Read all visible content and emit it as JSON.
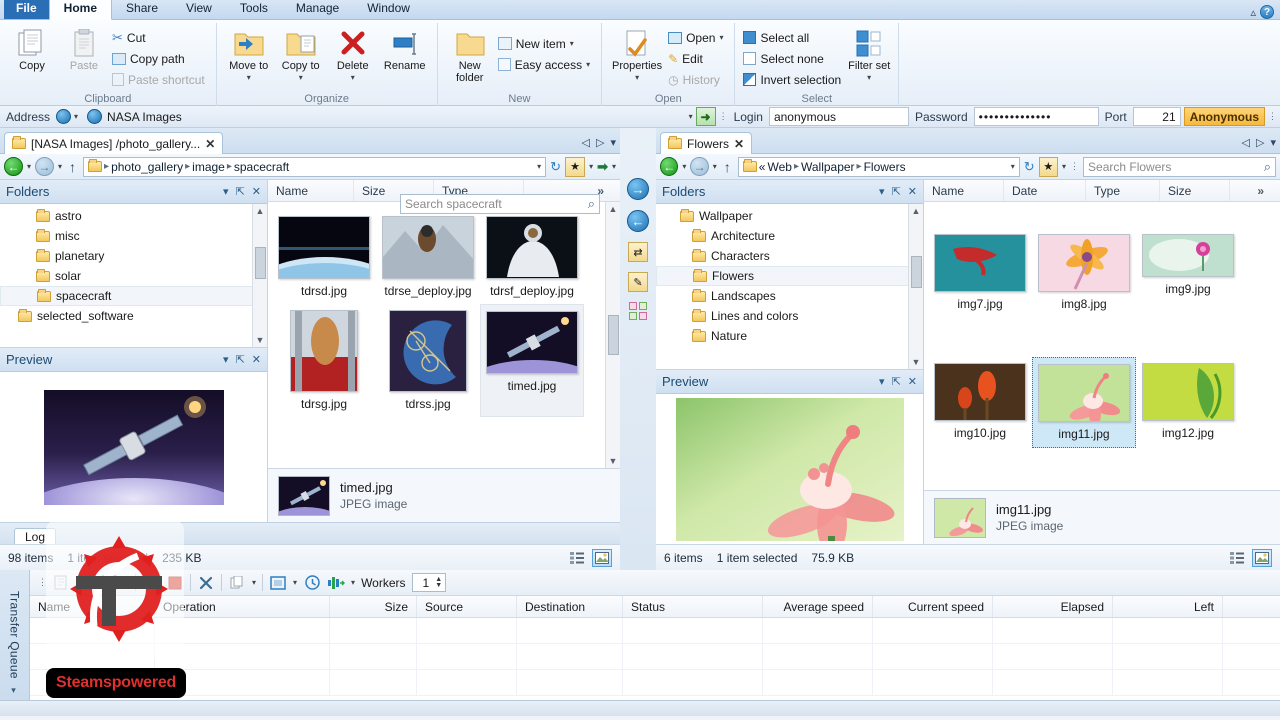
{
  "ribbon": {
    "tabs": [
      {
        "label": "File",
        "kind": "file"
      },
      {
        "label": "Home",
        "kind": "active"
      },
      {
        "label": "Share",
        "kind": "normal"
      },
      {
        "label": "View",
        "kind": "normal"
      },
      {
        "label": "Tools",
        "kind": "normal"
      },
      {
        "label": "Manage",
        "kind": "normal"
      },
      {
        "label": "Window",
        "kind": "normal"
      }
    ],
    "help_label": "?",
    "groups": {
      "clipboard": {
        "title": "Clipboard",
        "copy": "Copy",
        "paste": "Paste",
        "cut": "Cut",
        "copy_path": "Copy path",
        "paste_shortcut": "Paste shortcut"
      },
      "organize": {
        "title": "Organize",
        "move_to": "Move to",
        "copy_to": "Copy to",
        "delete": "Delete",
        "rename": "Rename"
      },
      "new": {
        "title": "New",
        "new_folder": "New folder",
        "new_item": "New item",
        "easy_access": "Easy access"
      },
      "open": {
        "title": "Open",
        "properties": "Properties",
        "open": "Open",
        "edit": "Edit",
        "history": "History"
      },
      "select": {
        "title": "Select",
        "select_all": "Select all",
        "select_none": "Select none",
        "invert_selection": "Invert selection",
        "filter_set": "Filter set"
      }
    }
  },
  "ftp_bar": {
    "address_label": "Address",
    "site_name": "NASA Images",
    "login_label": "Login",
    "login_value": "anonymous",
    "password_label": "Password",
    "password_value": "••••••••••••••",
    "port_label": "Port",
    "port_value": "21",
    "anonymous_label": "Anonymous",
    "go_label": "➜"
  },
  "left_pane": {
    "tab_label": "[NASA Images] /photo_gallery...",
    "tab_close": "✕",
    "breadcrumbs": [
      "photo_gallery",
      "image",
      "spacecraft"
    ],
    "search_placeholder": "Search spacecraft",
    "folders_panel": {
      "title": "Folders",
      "items": [
        {
          "label": "astro",
          "indent": 1,
          "selected": false
        },
        {
          "label": "misc",
          "indent": 1,
          "selected": false
        },
        {
          "label": "planetary",
          "indent": 1,
          "selected": false
        },
        {
          "label": "solar",
          "indent": 1,
          "selected": false
        },
        {
          "label": "spacecraft",
          "indent": 1,
          "selected": true
        },
        {
          "label": "selected_software",
          "indent": 0,
          "selected": false
        }
      ]
    },
    "preview_panel": {
      "title": "Preview"
    },
    "columns": [
      "Name",
      "Size",
      "Type"
    ],
    "files": [
      {
        "name": "tdrsd.jpg",
        "selected": false
      },
      {
        "name": "tdrse_deploy.jpg",
        "selected": false
      },
      {
        "name": "tdrsf_deploy.jpg",
        "selected": false
      },
      {
        "name": "tdrsg.jpg",
        "selected": false
      },
      {
        "name": "tdrss.jpg",
        "selected": false
      },
      {
        "name": "timed.jpg",
        "selected": true
      }
    ],
    "details": {
      "name": "timed.jpg",
      "type": "JPEG image"
    },
    "log_tab": "Log",
    "status": {
      "items": "98 items",
      "selected": "1 item selected",
      "size": "235 KB"
    }
  },
  "right_pane": {
    "tab_label": "Flowers",
    "tab_close": "✕",
    "breadcrumbs": [
      "Web",
      "Wallpaper",
      "Flowers"
    ],
    "breadcrumb_prefix": "«",
    "search_placeholder": "Search Flowers",
    "folders_panel": {
      "title": "Folders",
      "items": [
        {
          "label": "Wallpaper",
          "indent": 0,
          "selected": false
        },
        {
          "label": "Architecture",
          "indent": 1,
          "selected": false
        },
        {
          "label": "Characters",
          "indent": 1,
          "selected": false
        },
        {
          "label": "Flowers",
          "indent": 1,
          "selected": true
        },
        {
          "label": "Landscapes",
          "indent": 1,
          "selected": false
        },
        {
          "label": "Lines and colors",
          "indent": 1,
          "selected": false
        },
        {
          "label": "Nature",
          "indent": 1,
          "selected": false
        }
      ]
    },
    "preview_panel": {
      "title": "Preview"
    },
    "columns": [
      "Name",
      "Date",
      "Type",
      "Size"
    ],
    "files": [
      {
        "name": "img7.jpg",
        "selected": false
      },
      {
        "name": "img8.jpg",
        "selected": false
      },
      {
        "name": "img9.jpg",
        "selected": false
      },
      {
        "name": "img10.jpg",
        "selected": false
      },
      {
        "name": "img11.jpg",
        "selected": true
      },
      {
        "name": "img12.jpg",
        "selected": false
      }
    ],
    "details": {
      "name": "img11.jpg",
      "type": "JPEG image"
    },
    "status": {
      "items": "6 items",
      "selected": "1 item selected",
      "size": "75.9 KB"
    }
  },
  "transfer_queue": {
    "rail_label": "Transfer Queue",
    "workers_label": "Workers",
    "workers_value": "1",
    "columns": [
      "Name",
      "Operation",
      "Size",
      "Source",
      "Destination",
      "Status",
      "Average speed",
      "Current speed",
      "Elapsed",
      "Left"
    ]
  },
  "watermark": {
    "text": "Steamspowered"
  },
  "colors": {
    "accent": "#2a6fb5",
    "selection": "#cfe8f7",
    "anonymous_badge": "#f6b93b",
    "watermark_red": "#e03030"
  }
}
